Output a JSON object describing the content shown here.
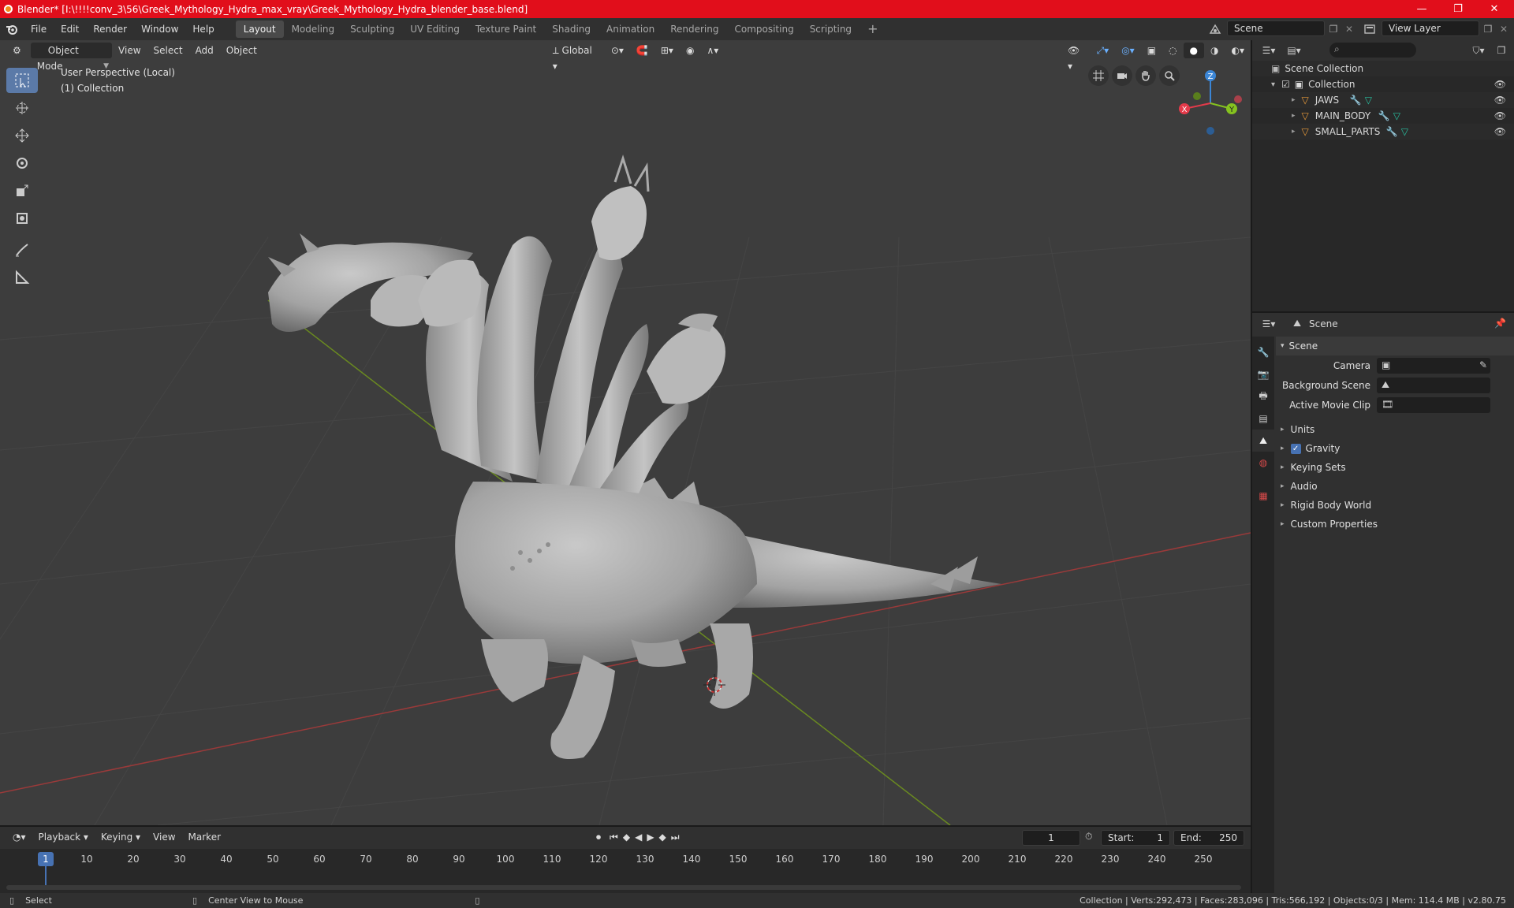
{
  "window": {
    "title": "Blender* [I:\\!!!!conv_3\\56\\Greek_Mythology_Hydra_max_vray\\Greek_Mythology_Hydra_blender_base.blend]",
    "minimize": "—",
    "maximize": "❐",
    "close": "✕"
  },
  "menu": {
    "items": [
      "File",
      "Edit",
      "Render",
      "Window",
      "Help"
    ],
    "workspaces": [
      "Layout",
      "Modeling",
      "Sculpting",
      "UV Editing",
      "Texture Paint",
      "Shading",
      "Animation",
      "Rendering",
      "Compositing",
      "Scripting"
    ],
    "active_workspace": "Layout",
    "add_workspace": "+",
    "scene": "Scene",
    "view_layer": "View Layer"
  },
  "viewport_header": {
    "mode": "Object Mode",
    "menus": [
      "View",
      "Select",
      "Add",
      "Object"
    ],
    "orientation": "Global"
  },
  "viewport": {
    "perspective": "User Perspective (Local)",
    "collection": "(1) Collection",
    "gizmo": {
      "x": "X",
      "y": "Y",
      "z": "Z"
    }
  },
  "outliner": {
    "root": "Scene Collection",
    "collection": "Collection",
    "objects": [
      "JAWS",
      "MAIN_BODY",
      "SMALL_PARTS"
    ]
  },
  "properties": {
    "header": "Scene",
    "panel": "Scene",
    "camera_label": "Camera",
    "background_scene_label": "Background Scene",
    "active_movie_clip_label": "Active Movie Clip",
    "sections": [
      "Units",
      "Gravity",
      "Keying Sets",
      "Audio",
      "Rigid Body World",
      "Custom Properties"
    ],
    "gravity_checked": true
  },
  "timeline": {
    "menus": [
      "Playback",
      "Keying",
      "View",
      "Marker"
    ],
    "current_frame": "1",
    "start_label": "Start:",
    "start": "1",
    "end_label": "End:",
    "end": "250",
    "ruler_ticks": [
      "1",
      "10",
      "20",
      "30",
      "40",
      "50",
      "60",
      "70",
      "80",
      "90",
      "100",
      "110",
      "120",
      "130",
      "140",
      "150",
      "160",
      "170",
      "180",
      "190",
      "200",
      "210",
      "220",
      "230",
      "240",
      "250"
    ]
  },
  "status": {
    "left_action": "Select",
    "middle_action": "Center View to Mouse",
    "stats": "Collection | Verts:292,473 | Faces:283,096 | Tris:566,192 | Objects:0/3 | Mem: 114.4 MB | v2.80.75"
  },
  "colors": {
    "titlebar": "#e10e1b",
    "accent": "#4772b3",
    "axis_x": "#e43a4a",
    "axis_y": "#85c21f",
    "axis_z": "#3b86d6"
  }
}
